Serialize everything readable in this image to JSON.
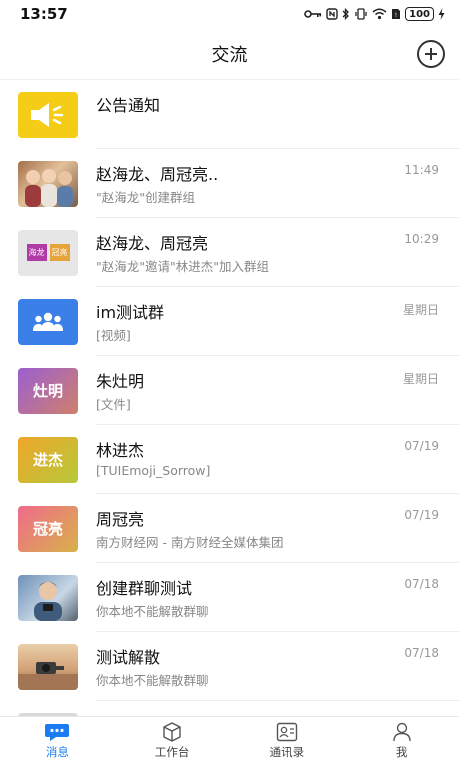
{
  "status_bar": {
    "time": "13:57",
    "battery": "100"
  },
  "header": {
    "title": "交流"
  },
  "conversations": [
    {
      "title": "公告通知",
      "subtitle": "",
      "time": "",
      "avatar_text": "",
      "avatar_type": "announcement",
      "avatar_color": "#f5cc16"
    },
    {
      "title": "赵海龙、周冠亮..",
      "subtitle": "\"赵海龙\"创建群组",
      "time": "11:49",
      "avatar_text": "",
      "avatar_type": "photo-group",
      "avatar_color": "#c9a27a"
    },
    {
      "title": "赵海龙、周冠亮",
      "subtitle": "\"赵海龙\"邀请\"林进杰\"加入群组",
      "time": "10:29",
      "avatar_text": "",
      "avatar_type": "name-pair",
      "avatar_color": "#e6e6e6",
      "avatar_labels": [
        "海龙",
        "冠亮"
      ]
    },
    {
      "title": "im测试群",
      "subtitle": "[视频]",
      "time": "星期日",
      "avatar_text": "",
      "avatar_type": "group-icon",
      "avatar_color": "#3b82f6"
    },
    {
      "title": "朱灶明",
      "subtitle": "[文件]",
      "time": "星期日",
      "avatar_text": "灶明",
      "avatar_type": "text",
      "avatar_color": "#b06ab3"
    },
    {
      "title": "林进杰",
      "subtitle": "[TUIEmoji_Sorrow]",
      "time": "07/19",
      "avatar_text": "进杰",
      "avatar_type": "text",
      "avatar_color": "#e9a52c"
    },
    {
      "title": "周冠亮",
      "subtitle": "南方财经网 - 南方财经全媒体集团",
      "time": "07/19",
      "avatar_text": "冠亮",
      "avatar_type": "text",
      "avatar_color": "#dd5e6e"
    },
    {
      "title": "创建群聊测试",
      "subtitle": "你本地不能解散群聊",
      "time": "07/18",
      "avatar_text": "",
      "avatar_type": "photo-person",
      "avatar_color": "#8aa7c4"
    },
    {
      "title": "测试解散",
      "subtitle": "你本地不能解散群聊",
      "time": "07/18",
      "avatar_text": "",
      "avatar_type": "photo-scene",
      "avatar_color": "#d9b48a"
    }
  ],
  "bottom_nav": [
    {
      "label": "消息",
      "icon": "chat-icon",
      "active": true
    },
    {
      "label": "工作台",
      "icon": "cube-icon",
      "active": false
    },
    {
      "label": "通讯录",
      "icon": "contacts-icon",
      "active": false
    },
    {
      "label": "我",
      "icon": "person-icon",
      "active": false
    }
  ],
  "colors": {
    "accent": "#1a7cf0",
    "divider": "#ececec"
  }
}
